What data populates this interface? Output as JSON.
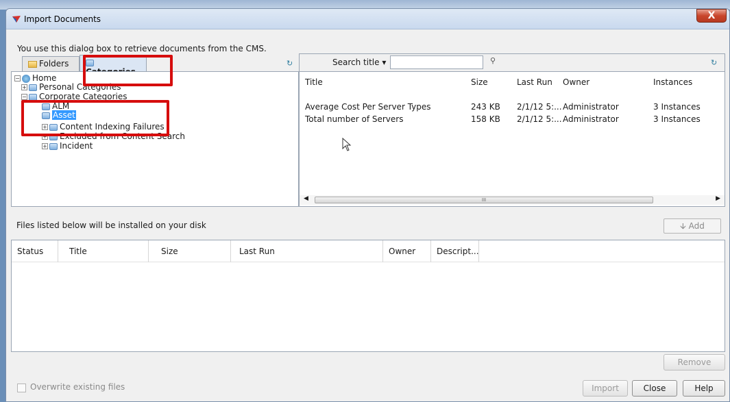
{
  "window": {
    "title": "Import Documents",
    "close_label": "X"
  },
  "intro_text": "You use this dialog box to retrieve documents from the CMS.",
  "left_tabs": {
    "folders": "Folders",
    "categories": "Categories"
  },
  "tree": [
    {
      "label": "Home",
      "expander": "⊟",
      "icon": "home-icon"
    },
    {
      "label": "Personal Categories",
      "expander": "⊞",
      "icon": "category-icon"
    },
    {
      "label": "Corporate Categories",
      "expander": "⊟",
      "icon": "category-icon"
    },
    {
      "label": "ALM",
      "icon": "category-icon"
    },
    {
      "label": "Asset",
      "icon": "category-icon",
      "selected": true
    },
    {
      "label": "Content Indexing Failures",
      "expander": "⊞",
      "icon": "category-icon"
    },
    {
      "label": "Excluded from Content Search",
      "expander": "⊞",
      "icon": "category-icon"
    },
    {
      "label": "Incident",
      "expander": "⊞",
      "icon": "category-icon"
    }
  ],
  "search": {
    "label": "Search title ▾",
    "value": ""
  },
  "doc_columns": [
    "Title",
    "Size",
    "Last Run",
    "Owner",
    "Instances"
  ],
  "docs": [
    {
      "title": "Average Cost Per Server Types",
      "size": "243 KB",
      "last_run": "2/1/12 5:...",
      "owner": "Administrator",
      "instances": "3 Instances"
    },
    {
      "title": "Total number of Servers",
      "size": "158 KB",
      "last_run": "2/1/12 5:...",
      "owner": "Administrator",
      "instances": "3 Instances"
    }
  ],
  "scroll_grip": "III",
  "files_label": "Files listed below will be installed on your disk",
  "add_label": "🡫 Add",
  "install_columns": [
    "Status",
    "Title",
    "Size",
    "Last Run",
    "Owner",
    "Descript..."
  ],
  "buttons": {
    "remove": "Remove",
    "import": "Import",
    "close": "Close",
    "help": "Help"
  },
  "overwrite_label": "Overwrite existing files",
  "colors": {
    "selection": "#3399ff",
    "highlight_box": "#d60d0d"
  }
}
